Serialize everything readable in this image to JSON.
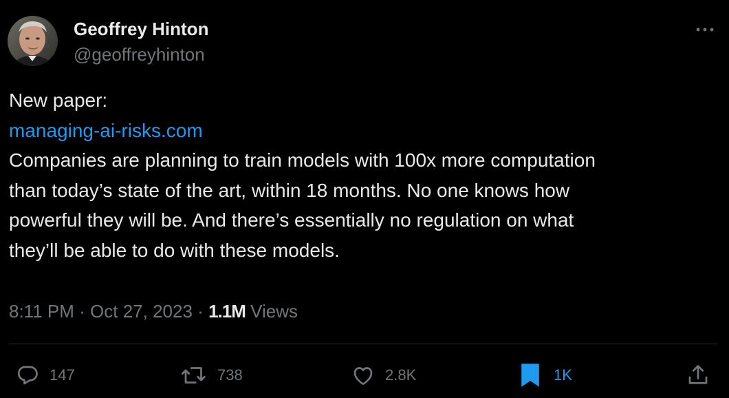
{
  "author": {
    "name": "Geoffrey Hinton",
    "handle": "@geoffreyhinton"
  },
  "tweet": {
    "intro": "New paper:",
    "link": "managing-ai-risks.com",
    "lines": [
      "Companies are planning to train models with 100x more computation",
      "than today’s state of the art, within 18 months. No one knows how",
      "powerful they will be. And there’s essentially no regulation on what",
      "they’ll be able to do with these models."
    ]
  },
  "meta": {
    "time": "8:11 PM",
    "separator": "·",
    "date": "Oct 27, 2023",
    "views_count": "1.1M",
    "views_label": "Views"
  },
  "actions": {
    "replies": "147",
    "reposts": "738",
    "likes": "2.8K",
    "bookmarks": "1K"
  },
  "icons": {
    "more": "more-dots-icon",
    "reply": "reply-bubble-icon",
    "repost": "repost-arrows-icon",
    "like": "heart-icon",
    "bookmark": "bookmark-icon",
    "share": "share-upload-icon"
  },
  "colors": {
    "background": "#000000",
    "text": "#e7e9ea",
    "muted": "#71767b",
    "accent": "#1d9bf0",
    "divider": "#2f3336"
  }
}
